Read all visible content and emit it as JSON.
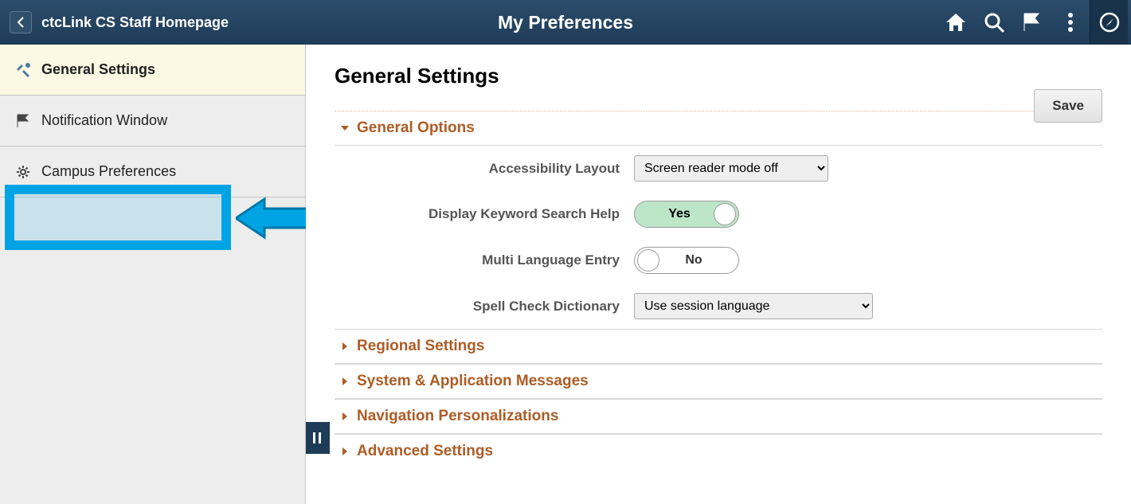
{
  "header": {
    "back_label": "ctcLink CS Staff Homepage",
    "title": "My Preferences"
  },
  "sidebar": {
    "items": [
      {
        "label": "General Settings"
      },
      {
        "label": "Notification Window"
      },
      {
        "label": "Campus Preferences"
      }
    ]
  },
  "main": {
    "heading": "General Settings",
    "save_label": "Save",
    "sections": {
      "general_options": {
        "title": "General Options",
        "rows": {
          "accessibility": {
            "label": "Accessibility Layout",
            "value": "Screen reader mode off"
          },
          "keyword_help": {
            "label": "Display Keyword Search Help",
            "value": "Yes"
          },
          "multi_lang": {
            "label": "Multi Language Entry",
            "value": "No"
          },
          "spell_check": {
            "label": "Spell Check Dictionary",
            "value": "Use session language"
          }
        }
      },
      "regional": {
        "title": "Regional Settings"
      },
      "sysmsg": {
        "title": "System & Application Messages"
      },
      "navpers": {
        "title": "Navigation Personalizations"
      },
      "advanced": {
        "title": "Advanced Settings"
      }
    }
  }
}
